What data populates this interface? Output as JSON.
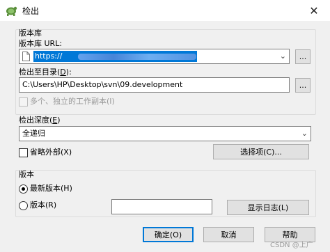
{
  "window": {
    "title": "检出",
    "close_glyph": "✕"
  },
  "repository": {
    "group_label": "版本库",
    "url_label": "版本库 URL:",
    "url_value": "https://",
    "browse_label": "...",
    "dest_label": "检出至目录(D):",
    "dest_value": "C:\\Users\\HP\\Desktop\\svn\\09.development",
    "dest_browse_label": "...",
    "multiple_label": "多个、独立的工作副本(I)"
  },
  "depth": {
    "label": "检出深度(E)",
    "selected": "全递归",
    "omit_externals_label": "省略外部(X)",
    "options_button": "选择项(C)..."
  },
  "revision": {
    "group_label": "版本",
    "head_label": "最新版本(H)",
    "rev_label": "版本(R)",
    "rev_value": "",
    "show_log_button": "显示日志(L)"
  },
  "buttons": {
    "ok": "确定(O)",
    "cancel": "取消",
    "help": "帮助"
  },
  "watermark": "CSDN @上广",
  "colors": {
    "accent": "#0078d7",
    "dialog_bg": "#f0f0f0"
  },
  "icons": [
    "tortoise-svn-icon",
    "close-icon",
    "document-icon",
    "dropdown-arrow-icon"
  ]
}
